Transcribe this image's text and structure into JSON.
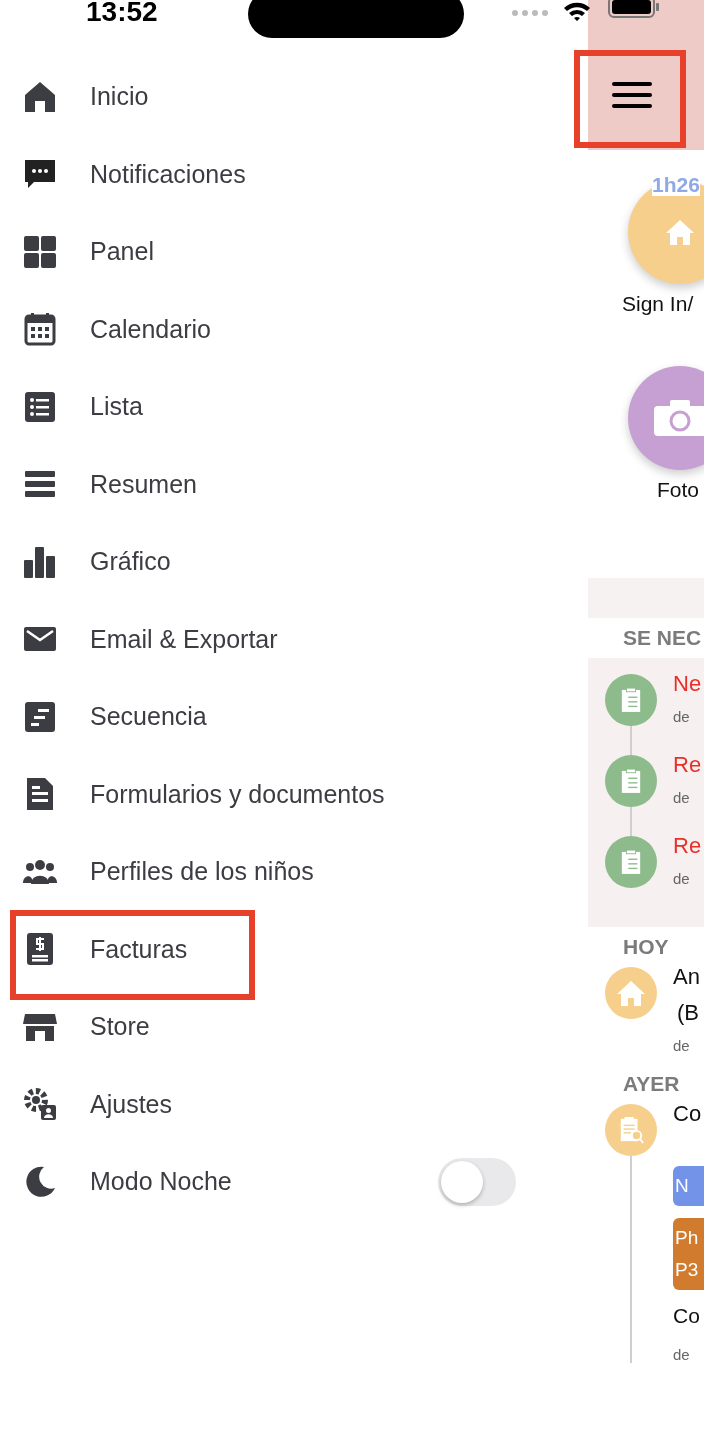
{
  "status_bar": {
    "time": "13:52"
  },
  "menu": {
    "items": [
      {
        "label": "Inicio",
        "kind": "link",
        "highlighted": false
      },
      {
        "label": "Notificaciones",
        "kind": "link",
        "highlighted": false
      },
      {
        "label": "Panel",
        "kind": "link",
        "highlighted": false
      },
      {
        "label": "Calendario",
        "kind": "link",
        "highlighted": false
      },
      {
        "label": "Lista",
        "kind": "link",
        "highlighted": false
      },
      {
        "label": "Resumen",
        "kind": "link",
        "highlighted": false
      },
      {
        "label": "Gráfico",
        "kind": "link",
        "highlighted": false
      },
      {
        "label": "Email & Exportar",
        "kind": "link",
        "highlighted": false
      },
      {
        "label": "Secuencia",
        "kind": "link",
        "highlighted": false
      },
      {
        "label": "Formularios y documentos",
        "kind": "link",
        "highlighted": false
      },
      {
        "label": "Perfiles de los niños",
        "kind": "link",
        "highlighted": false
      },
      {
        "label": "Facturas",
        "kind": "link",
        "highlighted": true
      },
      {
        "label": "Store",
        "kind": "link",
        "highlighted": false
      },
      {
        "label": "Ajustes",
        "kind": "link",
        "highlighted": false
      },
      {
        "label": "Modo Noche",
        "kind": "toggle",
        "on": false,
        "highlighted": false
      }
    ]
  },
  "content": {
    "menu_button": {
      "highlighted": true
    },
    "quick_actions": [
      {
        "label": "Sign In/",
        "badge": "1h26",
        "color": "#f6cf8c",
        "kind": "home"
      },
      {
        "label": "Foto",
        "color": "#c7a0d3",
        "kind": "camera"
      }
    ],
    "sections": [
      {
        "title": "SE NEC",
        "kind": "pending",
        "entries": [
          {
            "title_lines": [
              "Ne"
            ],
            "subtitle": "de",
            "color": "#8dbb8c",
            "kind": "checklist"
          },
          {
            "title_lines": [
              "Re"
            ],
            "subtitle": "de",
            "color": "#8dbb8c",
            "kind": "checklist"
          },
          {
            "title_lines": [
              "Re"
            ],
            "subtitle": "de",
            "color": "#8dbb8c",
            "kind": "checklist"
          }
        ]
      },
      {
        "title": "HOY",
        "kind": "feed",
        "entries": [
          {
            "title_lines": [
              "An",
              "(B"
            ],
            "subtitle": "de",
            "color": "#f6cf8c",
            "kind": "home"
          }
        ]
      },
      {
        "title": "AYER",
        "kind": "feed",
        "entries": [
          {
            "title_lines": [
              "Co"
            ],
            "tags": [
              {
                "lines": [
                  "N"
                ],
                "color": "#7293e8"
              },
              {
                "lines": [
                  "Ph",
                  "P3"
                ],
                "color": "#d07b2e"
              }
            ],
            "note": "Co",
            "subtitle": "de",
            "color": "#f6cf8c",
            "kind": "report"
          }
        ]
      }
    ]
  }
}
